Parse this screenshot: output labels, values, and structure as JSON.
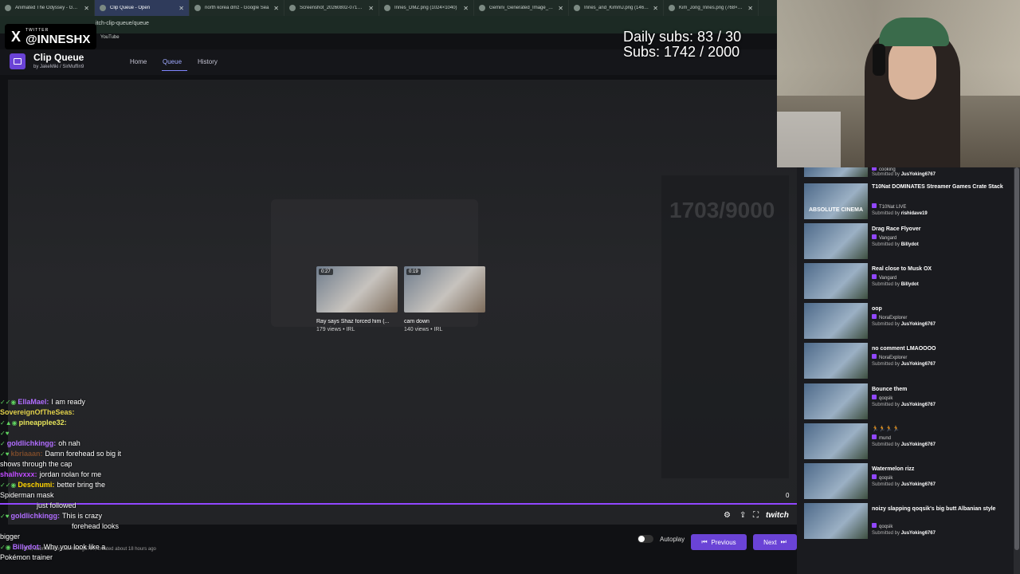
{
  "browser": {
    "tabs": [
      {
        "label": "Animated The Odyssey - Googl",
        "active": false
      },
      {
        "label": "Clip Queue - Open",
        "active": true
      },
      {
        "label": "north korea dmz - Google Sea",
        "active": false
      },
      {
        "label": "Screenshot_20260802-071502...",
        "active": false
      },
      {
        "label": "Innes_DMZ.png (1024×1040)",
        "active": false
      },
      {
        "label": "Gemini_Generated_Image_xz9i",
        "active": false
      },
      {
        "label": "Innes_and_KimmJ.png (1462×1",
        "active": false
      },
      {
        "label": "Kim_Jong_Innes.png (768×136",
        "active": false
      }
    ],
    "url_fragment": "itch-clip-queue/queue",
    "bookmark": "YouTube"
  },
  "overlay": {
    "twitter_small": "TWITTER",
    "twitter_handle": "@INNESHX",
    "daily_subs": "Daily subs: 83 / 30",
    "subs": "Subs: 1742 / 2000"
  },
  "app": {
    "title": "Clip Queue",
    "by_prefix": "by",
    "author1": "JakeMiki",
    "separator": "/",
    "author2": "SirMuffin9",
    "nav": {
      "home": "Home",
      "queue": "Queue",
      "history": "History"
    }
  },
  "player": {
    "ghost_count": "1703/9000",
    "suggestions": [
      {
        "duration": "0:27",
        "title": "Ray says Shaz forced him (...",
        "meta": "179 views • IRL"
      },
      {
        "duration": "0:19",
        "title": "cam down",
        "meta": "140 views • IRL"
      }
    ],
    "zero_counter": "0",
    "twitch_label": "twitch"
  },
  "controls": {
    "autoplay_label": "Autoplay",
    "autoplay_on": false,
    "previous_label": "Previous",
    "next_label": "Next",
    "clip_caption": "nt00, submitted by JusYoking6767, created about 18 hours ago"
  },
  "chat": [
    {
      "user": "EllaMael:",
      "color": "#b06cff",
      "message": "I am ready"
    },
    {
      "user": "SovereignOfTheSeas:",
      "color": "#e0d04a",
      "message": ""
    },
    {
      "user": "pineapplee32:",
      "color": "#e6e35a",
      "message": ""
    },
    {
      "user": "",
      "color": "#3b53ff",
      "message": ""
    },
    {
      "user": "goldlichkingg:",
      "color": "#b06cff",
      "message": "oh nah"
    },
    {
      "user": "kbriaaan:",
      "color": "#7a4a2a",
      "message": "Damn forehead so big it"
    },
    {
      "user": "",
      "color": "#ffffff",
      "message": "shows through the cap"
    },
    {
      "user": "shalhvxxx:",
      "color": "#c04bff",
      "message": "jordan nolan for me"
    },
    {
      "user": "Deschumi:",
      "color": "#ffd400",
      "message": "better bring the"
    },
    {
      "user": "",
      "color": "#ffffff",
      "message": "Spiderman mask"
    },
    {
      "user": "",
      "color": "#ffffff",
      "message": "just followed"
    },
    {
      "user": "goldlichkingg:",
      "color": "#b06cff",
      "message": "This is crazy"
    },
    {
      "user": "",
      "color": "#ffffff",
      "message": "forehead looks"
    },
    {
      "user": "",
      "color": "#ffffff",
      "message": "bigger"
    },
    {
      "user": "Billydot:",
      "color": "#b06cff",
      "message": "Why you look like a"
    },
    {
      "user": "",
      "color": "#ffffff",
      "message": "Pokémon trainer"
    }
  ],
  "queue": [
    {
      "title": "T10Nat DOMINATES Streamer Games Crate Stack",
      "channel": "T10Nat LIVE",
      "submitter": "rishidave19"
    },
    {
      "title": "Drag Race Flyover",
      "channel": "Vangard",
      "submitter": "Billydot"
    },
    {
      "title": "Real close to Musk OX",
      "channel": "Vangard",
      "submitter": "Billydot"
    },
    {
      "title": "oop",
      "channel": "NoraExplorer",
      "submitter": "JusYoking6767"
    },
    {
      "title": "no comment LMAOOOO",
      "channel": "NoraExplorer",
      "submitter": "JusYoking6767"
    },
    {
      "title": "Bounce them",
      "channel": "qoqsik",
      "submitter": "JusYoking6767"
    },
    {
      "title": "🏃🏃🏃🏃",
      "channel": "mund",
      "submitter": "JusYoking6767"
    },
    {
      "title": "Watermelon rizz",
      "channel": "qoqsik",
      "submitter": "JusYoking6767"
    },
    {
      "title": "noizy slapping qoqsik's big butt Albanian style",
      "channel": "qoqsik",
      "submitter": "JusYoking6767"
    }
  ],
  "queue_partial": {
    "title": "cooking",
    "submitter": "JusYoking6767"
  },
  "queue_thumb_overlay": "ABSOLUTE CINEMA",
  "submitted_by_label": "Submitted by"
}
